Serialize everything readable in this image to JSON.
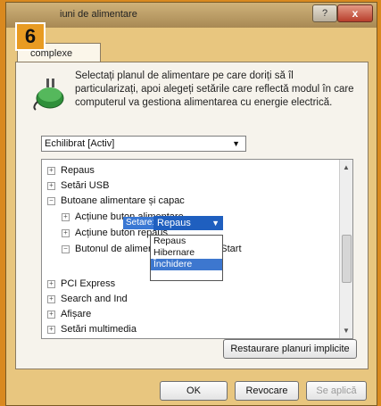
{
  "badge": "6",
  "window": {
    "title": "iuni de alimentare",
    "help": "?",
    "close": "x"
  },
  "tab": {
    "label": "complexe"
  },
  "description": "Selectați planul de alimentare pe care doriți să îl particularizați, apoi alegeți setările care reflectă modul în care computerul va gestiona alimentarea cu energie electrică.",
  "plan_select": {
    "value": "Echilibrat [Activ]"
  },
  "tree": [
    {
      "label": "Repaus",
      "exp": "+"
    },
    {
      "label": "Setări USB",
      "exp": "+"
    },
    {
      "label": "Butoane alimentare și capac",
      "exp": "−"
    },
    {
      "label": "Acțiune buton alimentare",
      "exp": "+"
    },
    {
      "label": "Acțiune buton repaus",
      "exp": "+"
    },
    {
      "label": "Butonul de alimentare din meniul Start",
      "exp": "−"
    },
    {
      "label": "PCI Express",
      "exp": "+"
    },
    {
      "label": "Search and Ind",
      "exp": "+"
    },
    {
      "label": "Afișare",
      "exp": "+"
    },
    {
      "label": "Setări multimedia",
      "exp": "+"
    }
  ],
  "setting": {
    "label": "Setare:",
    "value": "Repaus",
    "options": [
      "Repaus",
      "Hibernare",
      "Închidere"
    ],
    "selected_index": 2
  },
  "buttons": {
    "restore": "Restaurare planuri implicite",
    "ok": "OK",
    "cancel": "Revocare",
    "apply": "Se aplică"
  }
}
